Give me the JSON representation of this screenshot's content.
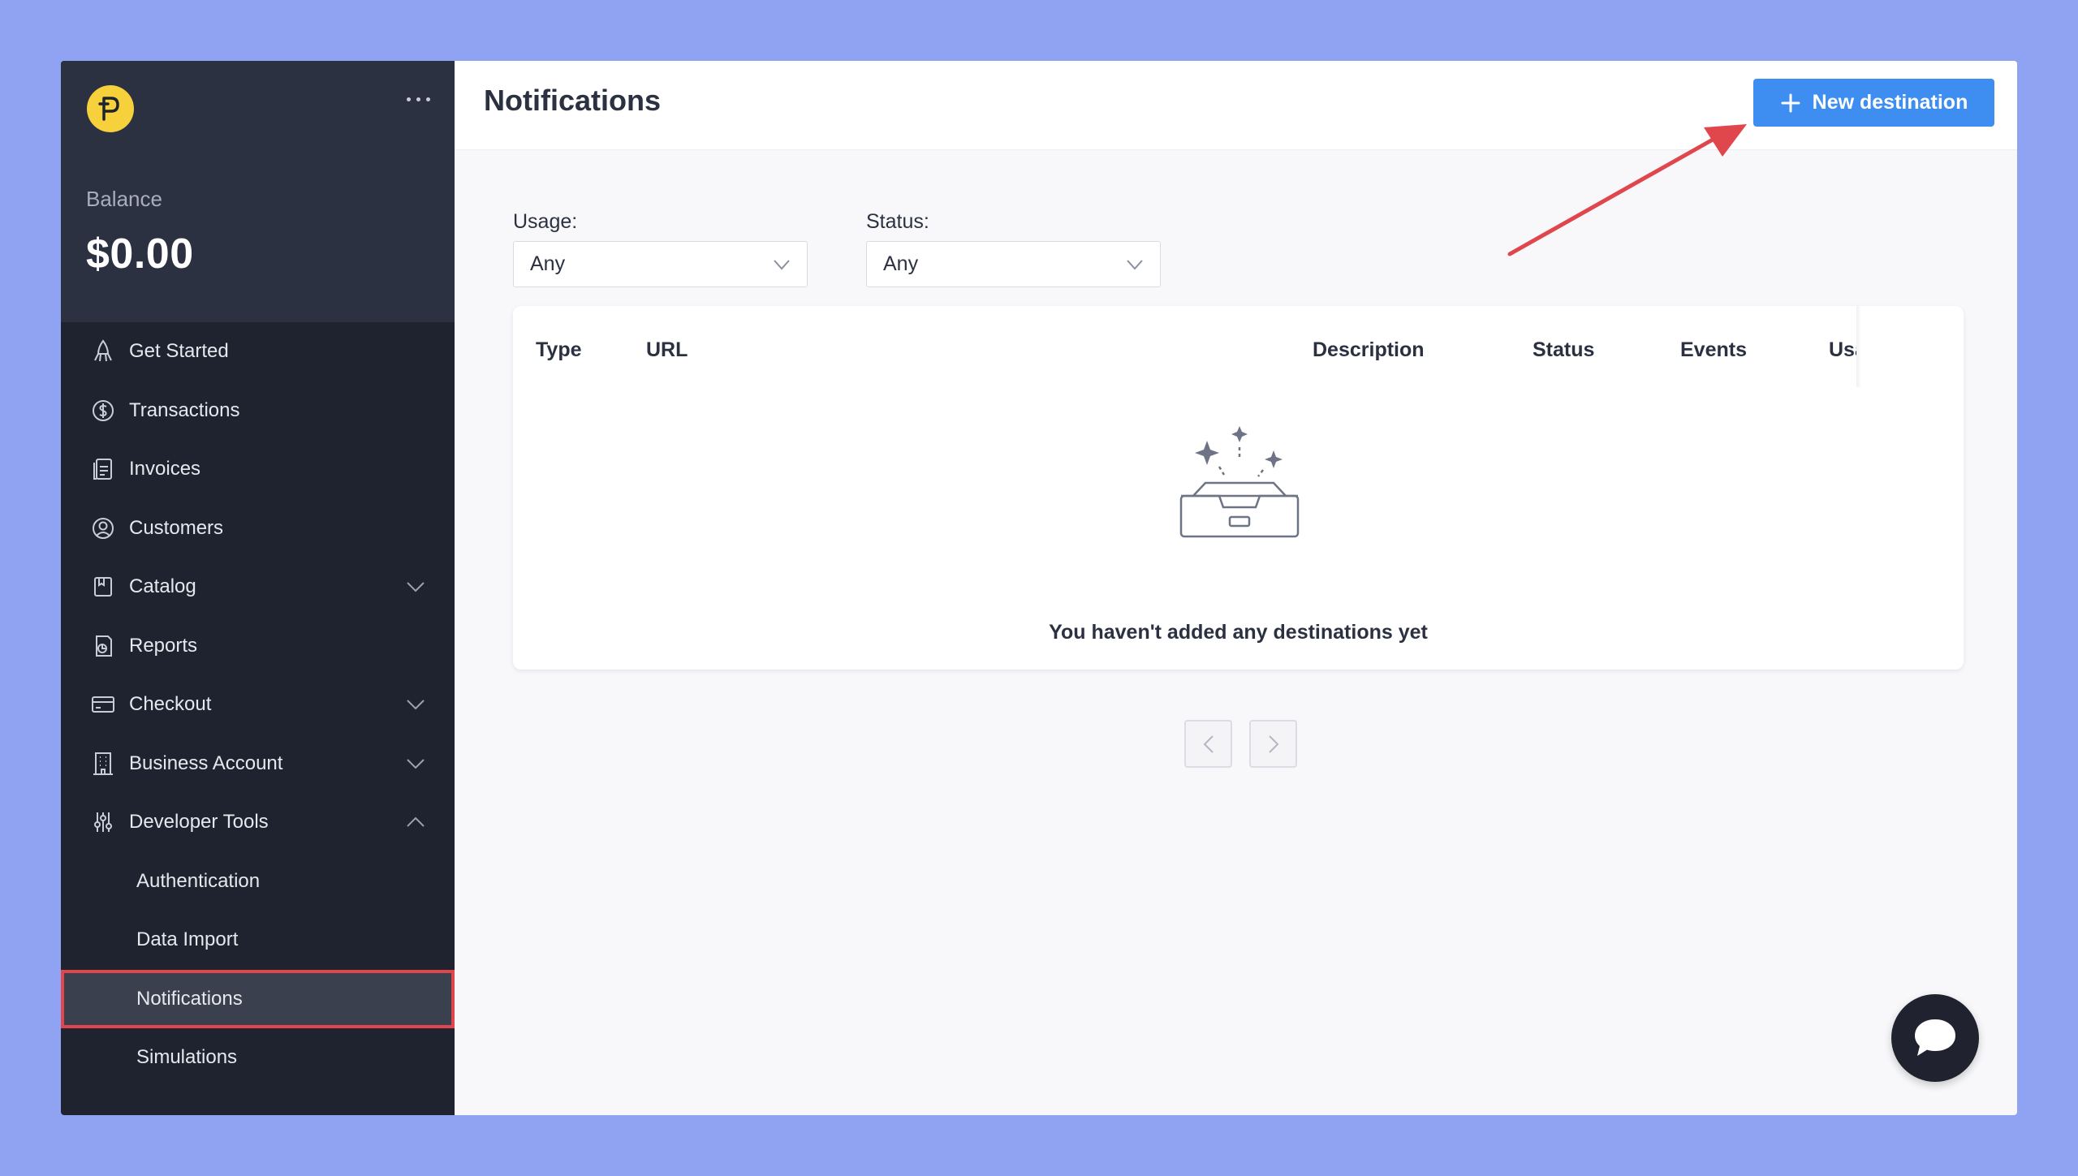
{
  "sidebar": {
    "balance_label": "Balance",
    "balance_value": "$0.00",
    "items": [
      {
        "label": "Get Started",
        "icon": "rocket-icon"
      },
      {
        "label": "Transactions",
        "icon": "dollar-circle-icon"
      },
      {
        "label": "Invoices",
        "icon": "invoice-icon"
      },
      {
        "label": "Customers",
        "icon": "user-circle-icon"
      },
      {
        "label": "Catalog",
        "icon": "catalog-icon"
      },
      {
        "label": "Reports",
        "icon": "report-icon"
      },
      {
        "label": "Checkout",
        "icon": "card-icon"
      },
      {
        "label": "Business Account",
        "icon": "building-icon"
      },
      {
        "label": "Developer Tools",
        "icon": "sliders-icon"
      }
    ],
    "subitems": [
      {
        "label": "Authentication"
      },
      {
        "label": "Data Import"
      },
      {
        "label": "Notifications"
      },
      {
        "label": "Simulations"
      }
    ]
  },
  "header": {
    "title": "Notifications",
    "new_button_label": "New destination"
  },
  "filters": {
    "usage_label": "Usage:",
    "usage_value": "Any",
    "status_label": "Status:",
    "status_value": "Any"
  },
  "table": {
    "columns": [
      "Type",
      "URL",
      "Description",
      "Status",
      "Events",
      "Usa"
    ],
    "empty_text": "You haven't added any destinations yet"
  },
  "colors": {
    "accent": "#3d8ef0",
    "sidebar_bg": "#1f2330",
    "highlight": "#e0474c",
    "logo": "#f7d13c"
  }
}
